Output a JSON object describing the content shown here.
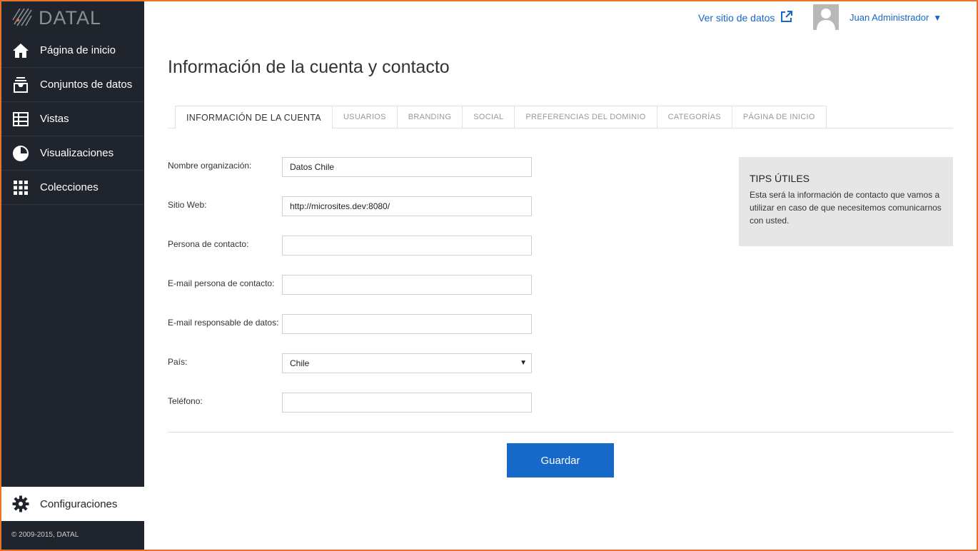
{
  "brand": {
    "name": "DATAL"
  },
  "sidebar": {
    "items": [
      {
        "label": "Página de inicio",
        "icon": "home-icon"
      },
      {
        "label": "Conjuntos de datos",
        "icon": "inbox-icon"
      },
      {
        "label": "Vistas",
        "icon": "table-icon"
      },
      {
        "label": "Visualizaciones",
        "icon": "pie-chart-icon"
      },
      {
        "label": "Colecciones",
        "icon": "grid-icon"
      }
    ],
    "settings_label": "Configuraciones",
    "copyright": "© 2009-2015, DATAL"
  },
  "header": {
    "view_site_label": "Ver sitio de datos",
    "user_name": "Juan Administrador",
    "user_caret": "▼"
  },
  "page": {
    "title": "Información de la cuenta y contacto"
  },
  "tabs": [
    {
      "label": "INFORMACIÓN DE LA CUENTA",
      "active": true
    },
    {
      "label": "USUARIOS"
    },
    {
      "label": "BRANDING"
    },
    {
      "label": "SOCIAL"
    },
    {
      "label": "PREFERENCIAS DEL DOMINIO"
    },
    {
      "label": "CATEGORÍAS"
    },
    {
      "label": "PÁGINA DE INICIO"
    }
  ],
  "form": {
    "org_name": {
      "label": "Nombre organización:",
      "value": "Datos Chile"
    },
    "website": {
      "label": "Sitio Web:",
      "value": "http://microsites.dev:8080/"
    },
    "contact_person": {
      "label": "Persona de contacto:",
      "value": ""
    },
    "contact_email": {
      "label": "E-mail persona de contacto:",
      "value": ""
    },
    "data_email": {
      "label": "E-mail responsable de datos:",
      "value": ""
    },
    "country": {
      "label": "País:",
      "value": "Chile"
    },
    "phone": {
      "label": "Teléfono:",
      "value": ""
    },
    "save_label": "Guardar"
  },
  "tips": {
    "title": "TIPS ÚTILES",
    "text": "Esta será la información de contacto que vamos a utilizar en caso de que necesitemos comunicarnos con usted."
  },
  "colors": {
    "sidebar": "#20252d",
    "accent": "#1668c9",
    "frame": "#e8742a"
  }
}
